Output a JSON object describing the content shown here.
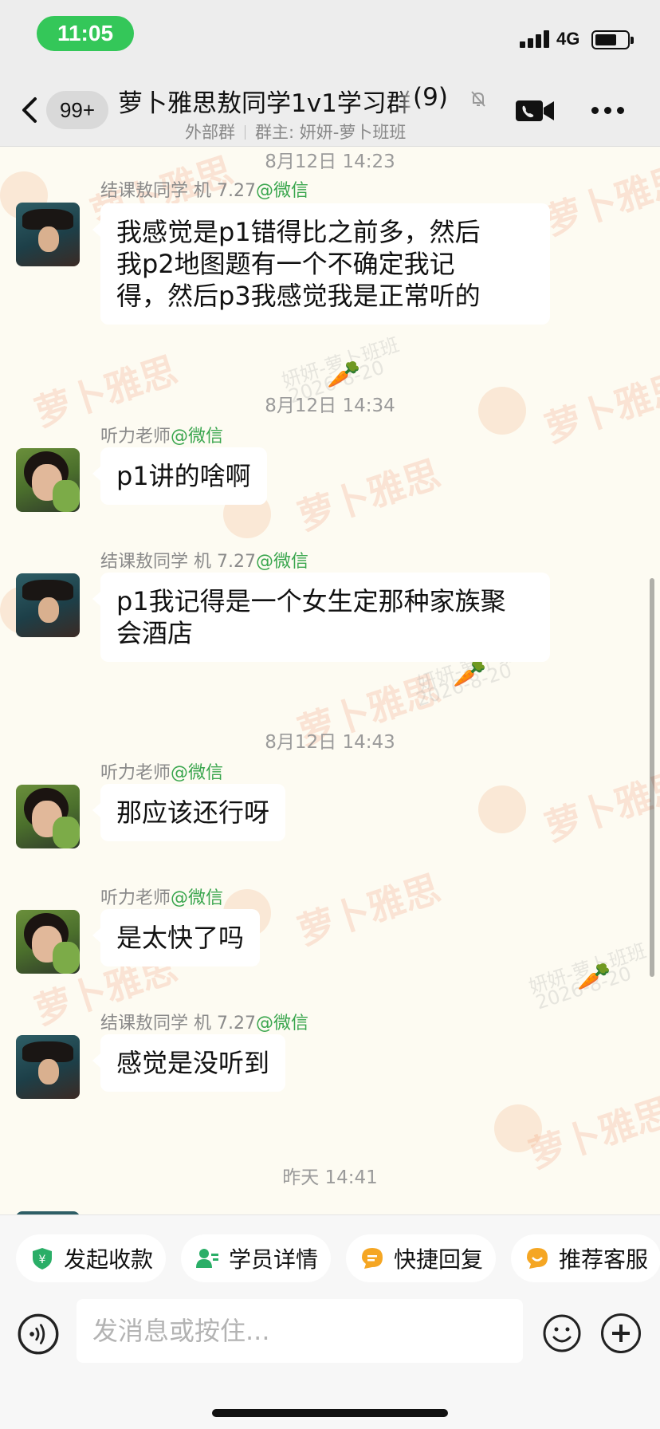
{
  "status_bar": {
    "time": "11:05",
    "network": "4G"
  },
  "header": {
    "unread_count": "99+",
    "group_title": "萝卜雅思敖同学1v1学习群",
    "member_count": "(9)",
    "subtitle_external": "外部群",
    "subtitle_owner": "群主: 妍妍-萝卜班班"
  },
  "watermark": {
    "brand": "萝卜雅思",
    "user": "妍妍-萝卜班班",
    "date": "2026-8-20"
  },
  "messages": [
    {
      "type": "timestamp",
      "text": "8月12日 14:23"
    },
    {
      "type": "message",
      "sender": "结课敖同学 机 7.27",
      "tag": "@微信",
      "avatar": "student",
      "lines": [
        "我感觉是p1错得比之前多，然后",
        "我p2地图题有一个不确定我记",
        "得，然后p3我感觉我是正常听的"
      ]
    },
    {
      "type": "timestamp",
      "text": "8月12日 14:34"
    },
    {
      "type": "message",
      "sender": "听力老师",
      "tag": "@微信",
      "avatar": "teacher",
      "lines": [
        "p1讲的啥啊"
      ]
    },
    {
      "type": "message",
      "sender": "结课敖同学 机 7.27",
      "tag": "@微信",
      "avatar": "student",
      "lines": [
        "p1我记得是一个女生定那种家族聚",
        "会酒店"
      ]
    },
    {
      "type": "timestamp",
      "text": "8月12日 14:43"
    },
    {
      "type": "message",
      "sender": "听力老师",
      "tag": "@微信",
      "avatar": "teacher",
      "lines": [
        "那应该还行呀"
      ]
    },
    {
      "type": "message",
      "sender": "听力老师",
      "tag": "@微信",
      "avatar": "teacher",
      "lines": [
        "是太快了吗"
      ]
    },
    {
      "type": "message",
      "sender": "结课敖同学 机 7.27",
      "tag": "@微信",
      "avatar": "student",
      "lines": [
        "感觉是没听到"
      ]
    },
    {
      "type": "timestamp",
      "text": "昨天 14:41"
    }
  ],
  "quick_actions": [
    {
      "label": "发起收款",
      "icon": "payment-icon",
      "color": "#2aae67"
    },
    {
      "label": "学员详情",
      "icon": "student-profile-icon",
      "color": "#2aae67"
    },
    {
      "label": "快捷回复",
      "icon": "quick-reply-icon",
      "color": "#f5a623"
    },
    {
      "label": "推荐客服",
      "icon": "recommend-service-icon",
      "color": "#f5a623"
    }
  ],
  "input": {
    "placeholder": "发消息或按住..."
  }
}
